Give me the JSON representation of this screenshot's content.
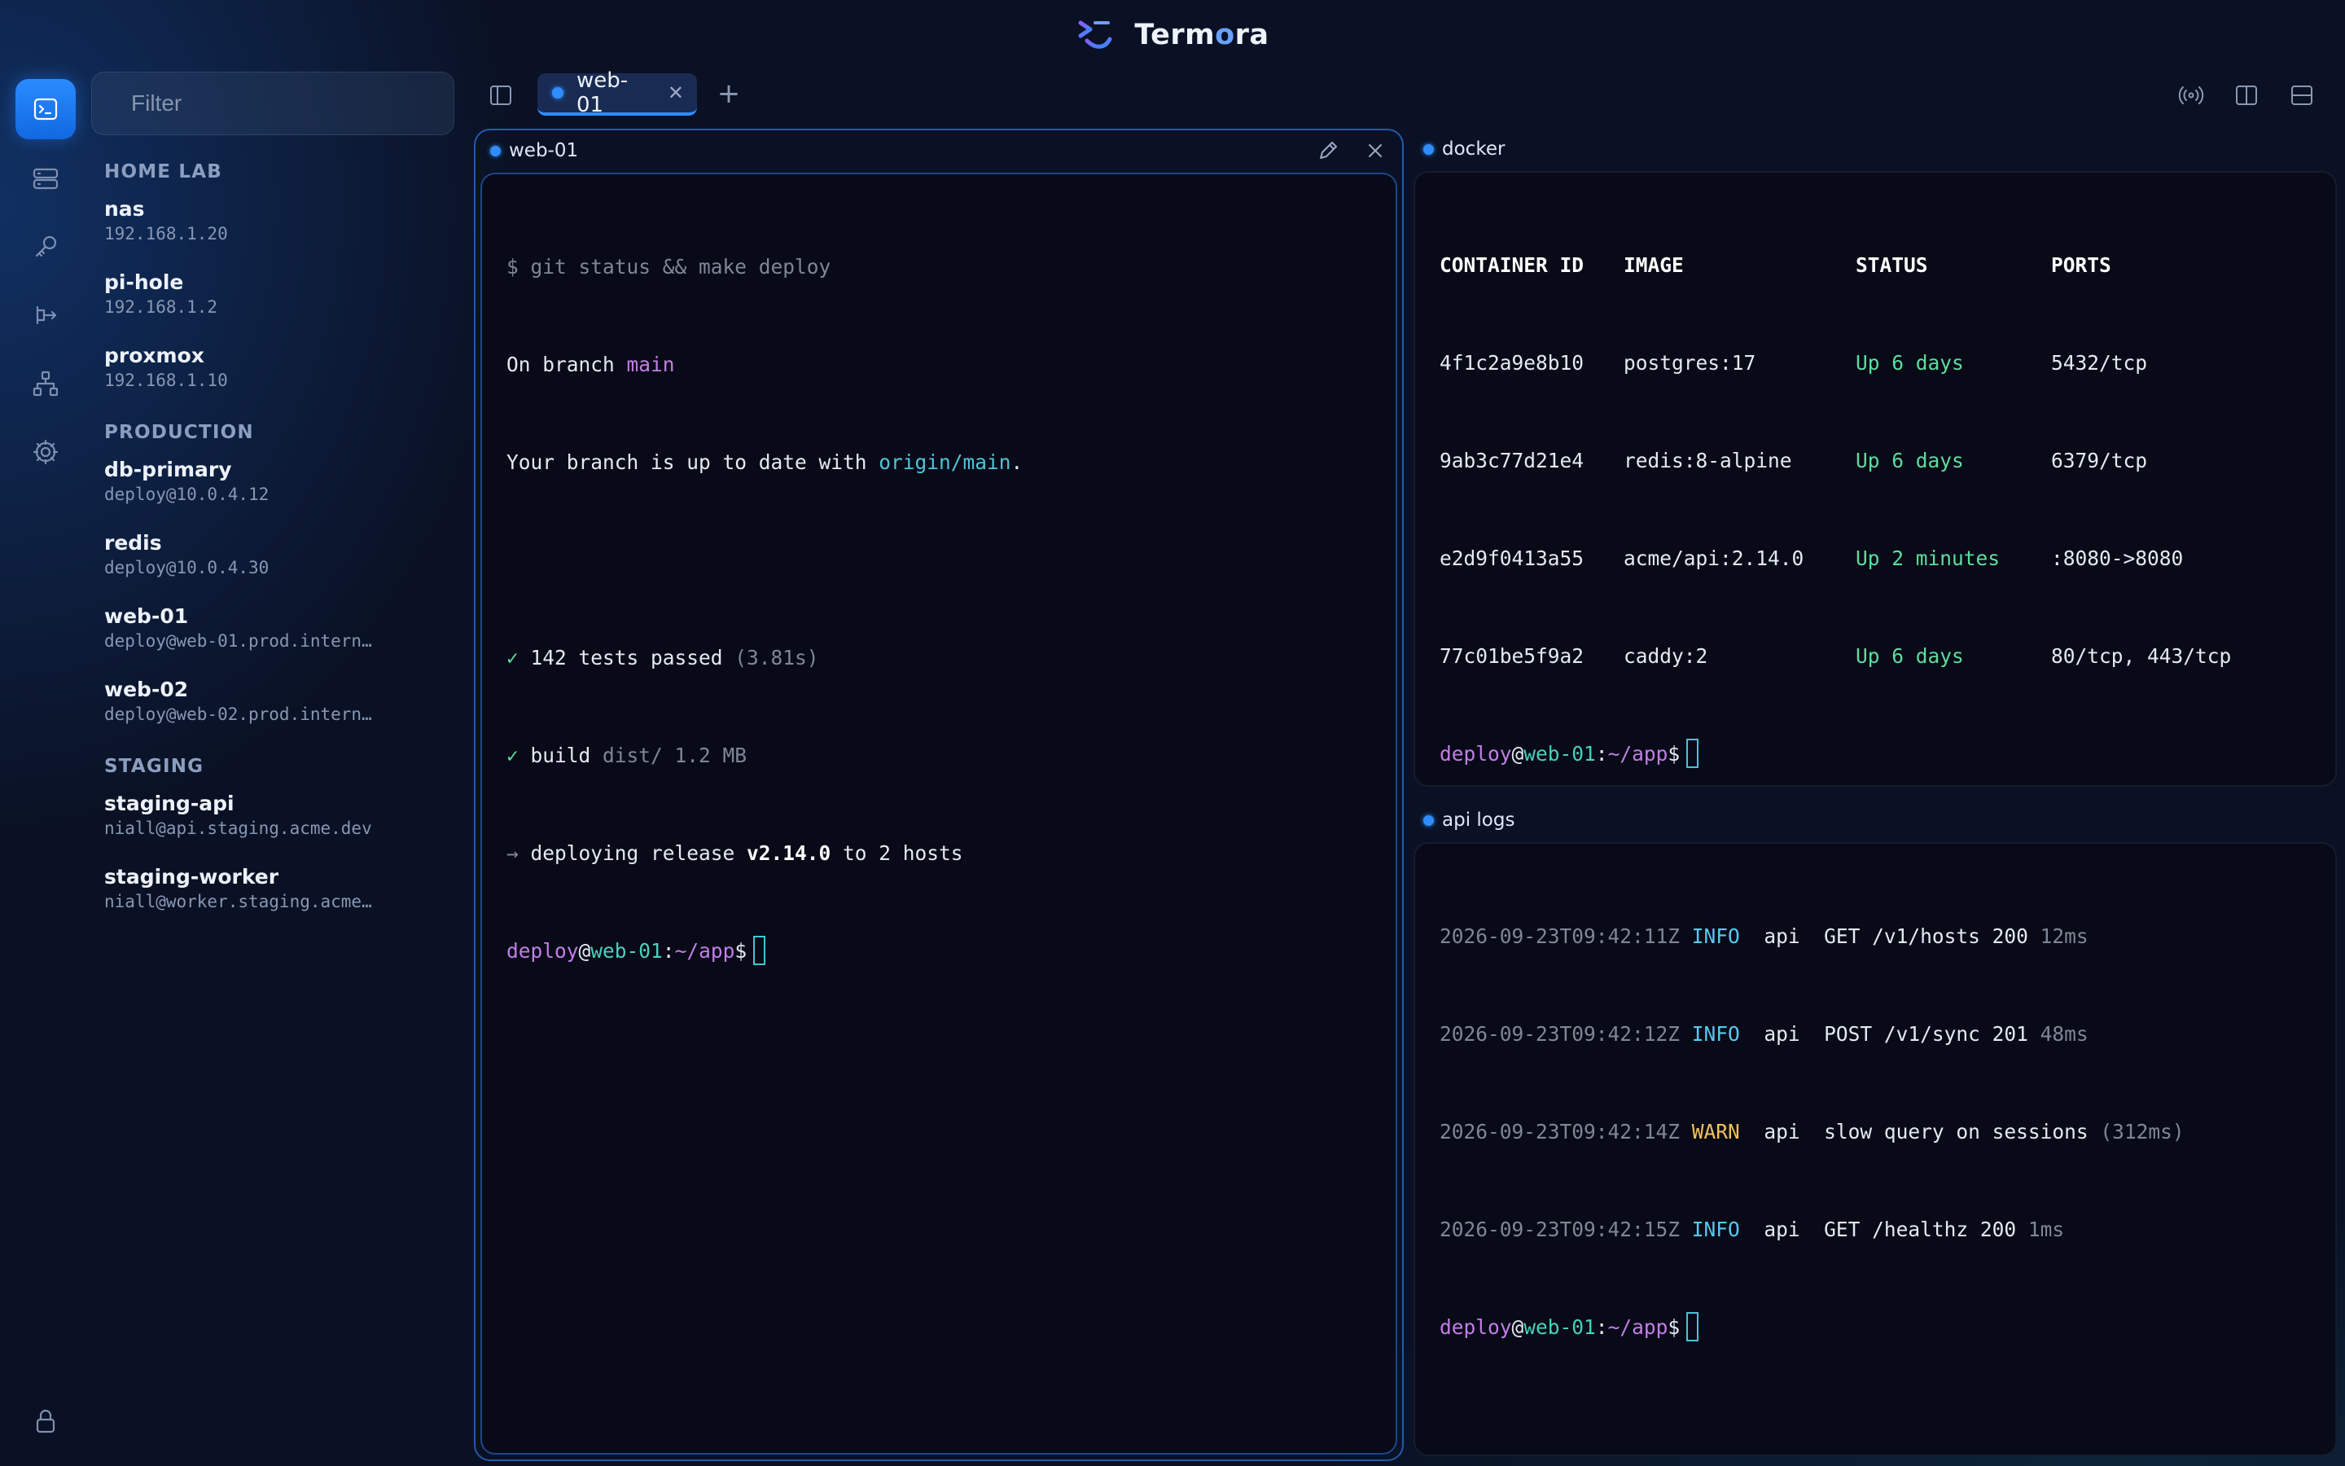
{
  "app": {
    "title_main": "Term",
    "title_accent": "o",
    "title_end": "ra"
  },
  "rail": {
    "items": [
      {
        "icon": "terminal-icon",
        "active": true
      },
      {
        "icon": "hosts-icon"
      },
      {
        "icon": "key-icon"
      },
      {
        "icon": "port-forward-icon"
      },
      {
        "icon": "network-icon"
      },
      {
        "icon": "gear-icon"
      }
    ],
    "bottom_icon": "lock-icon"
  },
  "sidebar": {
    "filter_placeholder": "Filter",
    "groups": [
      {
        "label": "HOME LAB",
        "hosts": [
          {
            "name": "nas",
            "addr": "192.168.1.20"
          },
          {
            "name": "pi-hole",
            "addr": "192.168.1.2"
          },
          {
            "name": "proxmox",
            "addr": "192.168.1.10"
          }
        ]
      },
      {
        "label": "PRODUCTION",
        "hosts": [
          {
            "name": "db-primary",
            "addr": "deploy@10.0.4.12"
          },
          {
            "name": "redis",
            "addr": "deploy@10.0.4.30"
          },
          {
            "name": "web-01",
            "addr": "deploy@web-01.prod.intern…"
          },
          {
            "name": "web-02",
            "addr": "deploy@web-02.prod.intern…"
          }
        ]
      },
      {
        "label": "STAGING",
        "hosts": [
          {
            "name": "staging-api",
            "addr": "niall@api.staging.acme.dev"
          },
          {
            "name": "staging-worker",
            "addr": "niall@worker.staging.acme…"
          }
        ]
      }
    ]
  },
  "tabs": [
    {
      "label": "web-01",
      "close": "✕",
      "active": true
    }
  ],
  "tabbar": {
    "new_tab": "+"
  },
  "panes": {
    "main": {
      "title": "web-01",
      "lines": {
        "cmd": "$ git status && make deploy",
        "branch_pre": "On branch ",
        "branch": "main",
        "uptodate_pre": "Your branch is up to date with ",
        "uptodate_ref": "origin/main",
        "uptodate_post": ".",
        "tests_check": "✓",
        "tests_text": " 142 tests passed ",
        "tests_time": "(3.81s)",
        "build_check": "✓",
        "build_text": " build ",
        "build_dim": "dist/ 1.2 MB",
        "deploy_arrow": "→",
        "deploy_pre": " deploying release ",
        "deploy_ver": "v2.14.0",
        "deploy_post": " to 2 hosts"
      },
      "prompt": {
        "user": "deploy",
        "at": "@",
        "host": "web-01",
        "colon": ":",
        "path": "~/app",
        "dollar": "$"
      }
    },
    "docker": {
      "title": "docker",
      "headers": [
        "CONTAINER ID",
        "IMAGE",
        "STATUS",
        "PORTS"
      ],
      "rows": [
        [
          "4f1c2a9e8b10",
          "postgres:17",
          "Up 6 days",
          "5432/tcp"
        ],
        [
          "9ab3c77d21e4",
          "redis:8-alpine",
          "Up 6 days",
          "6379/tcp"
        ],
        [
          "e2d9f0413a55",
          "acme/api:2.14.0",
          "Up 2 minutes",
          ":8080->8080"
        ],
        [
          "77c01be5f9a2",
          "caddy:2",
          "Up 6 days",
          "80/tcp, 443/tcp"
        ]
      ],
      "prompt": {
        "user": "deploy",
        "at": "@",
        "host": "web-01",
        "colon": ":",
        "path": "~/app",
        "dollar": "$"
      }
    },
    "logs": {
      "title": "api logs",
      "rows": [
        {
          "ts": "2026-09-23T09:42:11Z",
          "level": "INFO",
          "svc": "api",
          "msg": "GET /v1/hosts 200",
          "dur": "12ms"
        },
        {
          "ts": "2026-09-23T09:42:12Z",
          "level": "INFO",
          "svc": "api",
          "msg": "POST /v1/sync 201",
          "dur": "48ms"
        },
        {
          "ts": "2026-09-23T09:42:14Z",
          "level": "WARN",
          "svc": "api",
          "msg": "slow query on sessions",
          "dur": "(312ms)"
        },
        {
          "ts": "2026-09-23T09:42:15Z",
          "level": "INFO",
          "svc": "api",
          "msg": "GET /healthz 200",
          "dur": "1ms"
        }
      ],
      "prompt": {
        "user": "deploy",
        "at": "@",
        "host": "web-01",
        "colon": ":",
        "path": "~/app",
        "dollar": "$"
      }
    }
  },
  "colors": {
    "accent": "#2f8dff",
    "background": "#0a1124",
    "terminal_bg": "#080a17",
    "success": "#5fdc9e",
    "warning": "#f2c060"
  }
}
